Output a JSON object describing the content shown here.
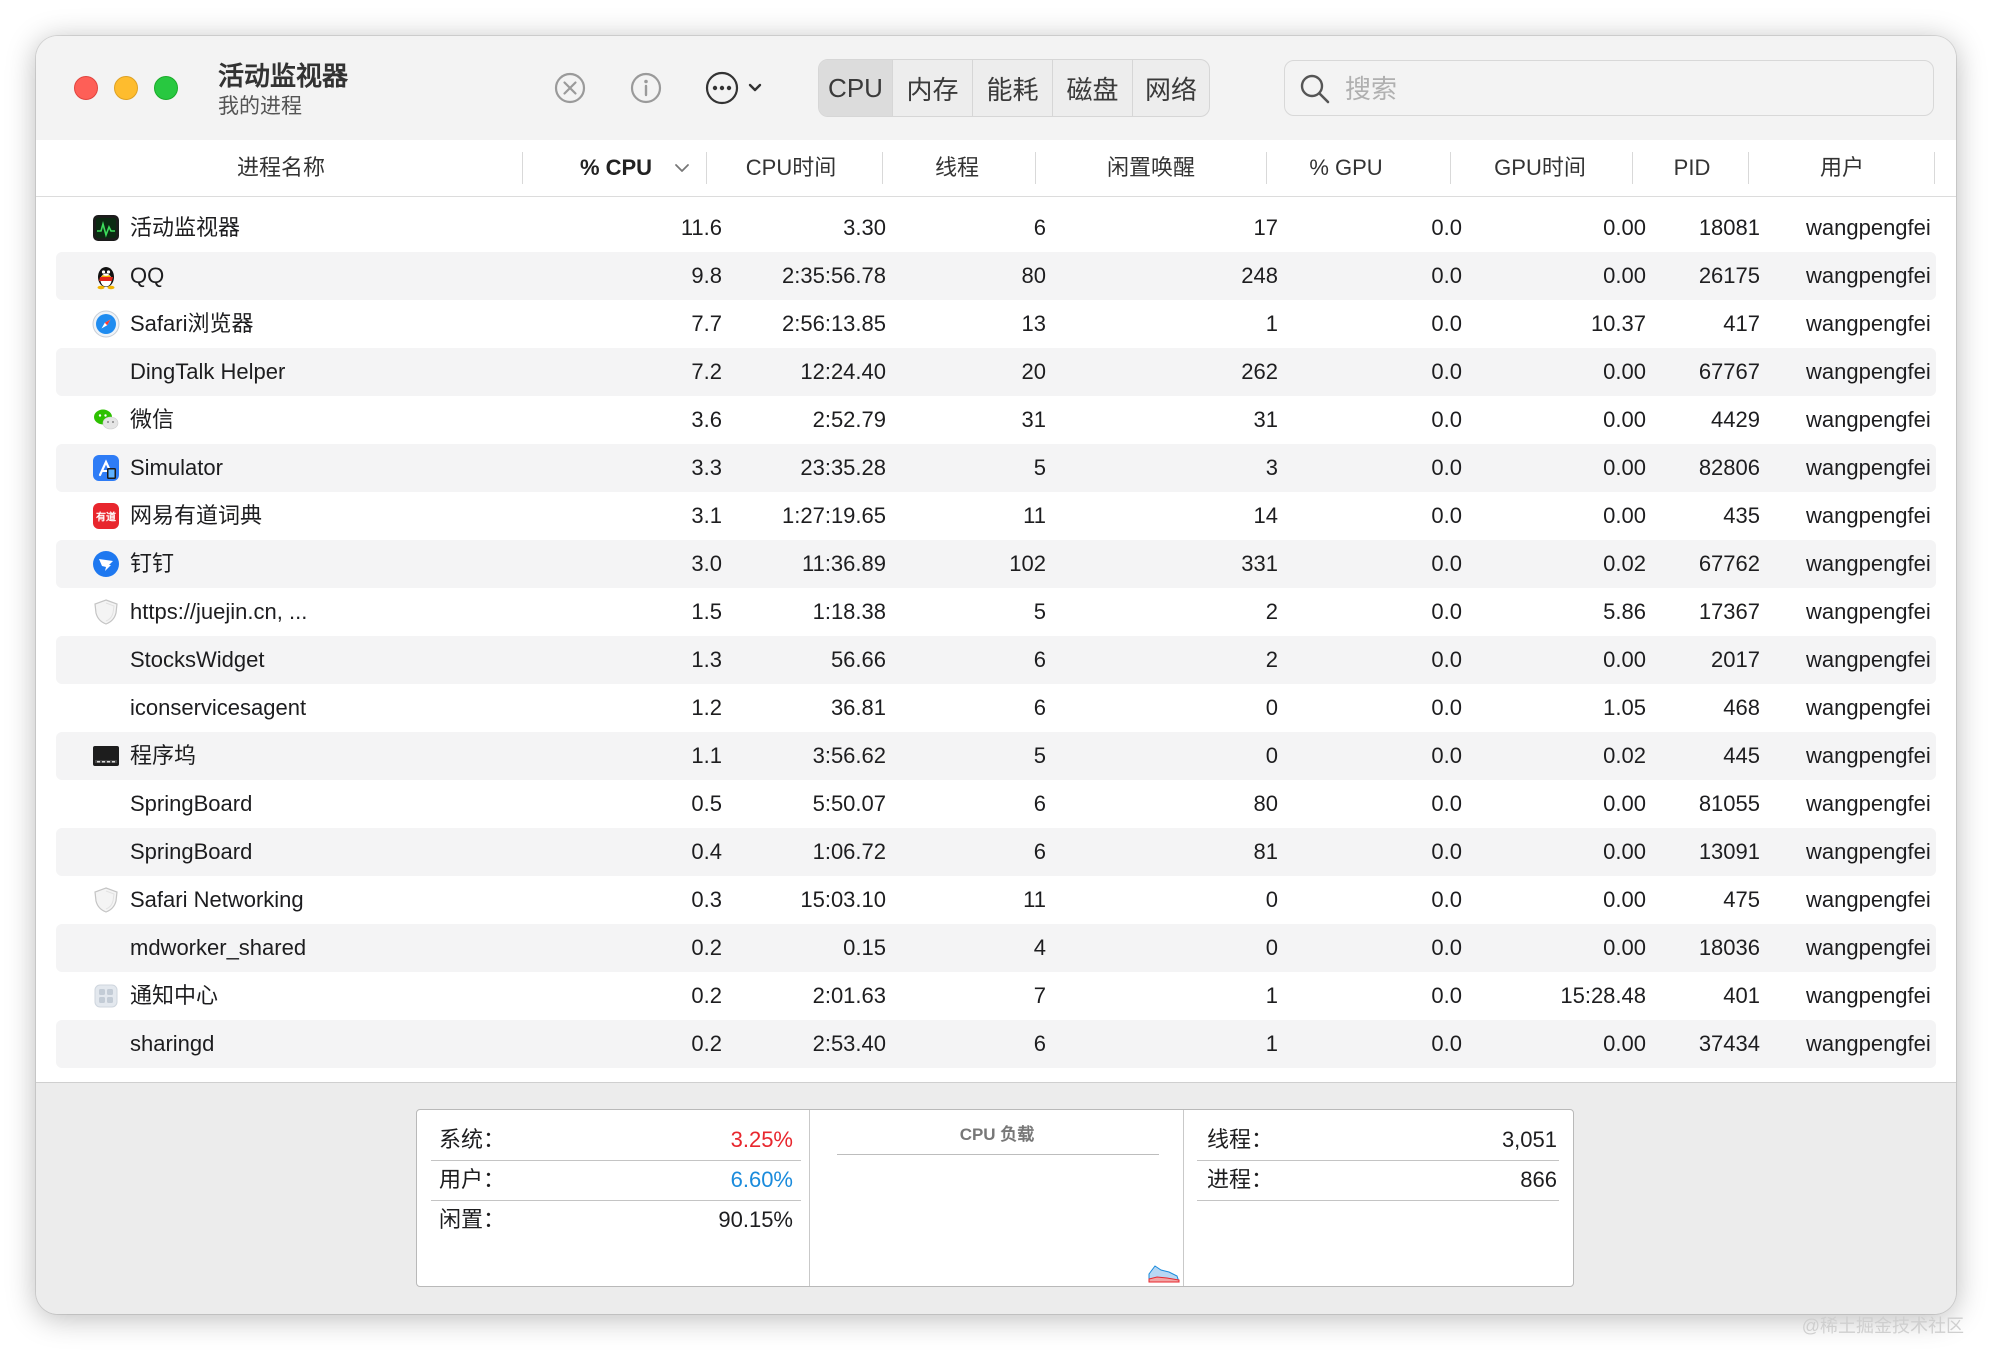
{
  "app": {
    "title": "活动监视器",
    "subtitle": "我的进程"
  },
  "toolbar": {
    "icons": [
      "stop-process-icon",
      "info-icon",
      "more-actions-icon"
    ],
    "tabs": [
      "CPU",
      "内存",
      "能耗",
      "磁盘",
      "网络"
    ],
    "active_tab": "CPU",
    "search": {
      "placeholder": "搜索",
      "value": ""
    }
  },
  "table": {
    "columns": [
      "进程名称",
      "% CPU",
      "CPU时间",
      "线程",
      "闲置唤醒",
      "% GPU",
      "GPU时间",
      "PID",
      "用户"
    ],
    "sort_column": "% CPU",
    "sort_direction": "descending",
    "rows": [
      {
        "icon": "activity-monitor-icon",
        "name": "活动监视器",
        "cpu": "11.6",
        "cpu_time": "3.30",
        "threads": "6",
        "idle_wakeups": "17",
        "gpu": "0.0",
        "gpu_time": "0.00",
        "pid": "18081",
        "user": "wangpengfei"
      },
      {
        "icon": "qq-penguin-icon",
        "name": "QQ",
        "cpu": "9.8",
        "cpu_time": "2:35:56.78",
        "threads": "80",
        "idle_wakeups": "248",
        "gpu": "0.0",
        "gpu_time": "0.00",
        "pid": "26175",
        "user": "wangpengfei"
      },
      {
        "icon": "safari-compass-icon",
        "name": "Safari浏览器",
        "cpu": "7.7",
        "cpu_time": "2:56:13.85",
        "threads": "13",
        "idle_wakeups": "1",
        "gpu": "0.0",
        "gpu_time": "10.37",
        "pid": "417",
        "user": "wangpengfei"
      },
      {
        "icon": "",
        "name": "DingTalk Helper",
        "cpu": "7.2",
        "cpu_time": "12:24.40",
        "threads": "20",
        "idle_wakeups": "262",
        "gpu": "0.0",
        "gpu_time": "0.00",
        "pid": "67767",
        "user": "wangpengfei"
      },
      {
        "icon": "wechat-icon",
        "name": "微信",
        "cpu": "3.6",
        "cpu_time": "2:52.79",
        "threads": "31",
        "idle_wakeups": "31",
        "gpu": "0.0",
        "gpu_time": "0.00",
        "pid": "4429",
        "user": "wangpengfei"
      },
      {
        "icon": "simulator-icon",
        "name": "Simulator",
        "cpu": "3.3",
        "cpu_time": "23:35.28",
        "threads": "5",
        "idle_wakeups": "3",
        "gpu": "0.0",
        "gpu_time": "0.00",
        "pid": "82806",
        "user": "wangpengfei"
      },
      {
        "icon": "youdao-dict-icon",
        "name": "网易有道词典",
        "cpu": "3.1",
        "cpu_time": "1:27:19.65",
        "threads": "11",
        "idle_wakeups": "14",
        "gpu": "0.0",
        "gpu_time": "0.00",
        "pid": "435",
        "user": "wangpengfei"
      },
      {
        "icon": "dingtalk-icon",
        "name": "钉钉",
        "cpu": "3.0",
        "cpu_time": "11:36.89",
        "threads": "102",
        "idle_wakeups": "331",
        "gpu": "0.0",
        "gpu_time": "0.02",
        "pid": "67762",
        "user": "wangpengfei"
      },
      {
        "icon": "shield-icon",
        "name": "https://juejin.cn, ...",
        "cpu": "1.5",
        "cpu_time": "1:18.38",
        "threads": "5",
        "idle_wakeups": "2",
        "gpu": "0.0",
        "gpu_time": "5.86",
        "pid": "17367",
        "user": "wangpengfei"
      },
      {
        "icon": "",
        "name": "StocksWidget",
        "cpu": "1.3",
        "cpu_time": "56.66",
        "threads": "6",
        "idle_wakeups": "2",
        "gpu": "0.0",
        "gpu_time": "0.00",
        "pid": "2017",
        "user": "wangpengfei"
      },
      {
        "icon": "",
        "name": "iconservicesagent",
        "cpu": "1.2",
        "cpu_time": "36.81",
        "threads": "6",
        "idle_wakeups": "0",
        "gpu": "0.0",
        "gpu_time": "1.05",
        "pid": "468",
        "user": "wangpengfei"
      },
      {
        "icon": "terminal-icon",
        "name": "程序坞",
        "cpu": "1.1",
        "cpu_time": "3:56.62",
        "threads": "5",
        "idle_wakeups": "0",
        "gpu": "0.0",
        "gpu_time": "0.02",
        "pid": "445",
        "user": "wangpengfei"
      },
      {
        "icon": "",
        "name": "SpringBoard",
        "cpu": "0.5",
        "cpu_time": "5:50.07",
        "threads": "6",
        "idle_wakeups": "80",
        "gpu": "0.0",
        "gpu_time": "0.00",
        "pid": "81055",
        "user": "wangpengfei"
      },
      {
        "icon": "",
        "name": "SpringBoard",
        "cpu": "0.4",
        "cpu_time": "1:06.72",
        "threads": "6",
        "idle_wakeups": "81",
        "gpu": "0.0",
        "gpu_time": "0.00",
        "pid": "13091",
        "user": "wangpengfei"
      },
      {
        "icon": "shield-icon",
        "name": "Safari Networking",
        "cpu": "0.3",
        "cpu_time": "15:03.10",
        "threads": "11",
        "idle_wakeups": "0",
        "gpu": "0.0",
        "gpu_time": "0.00",
        "pid": "475",
        "user": "wangpengfei"
      },
      {
        "icon": "",
        "name": "mdworker_shared",
        "cpu": "0.2",
        "cpu_time": "0.15",
        "threads": "4",
        "idle_wakeups": "0",
        "gpu": "0.0",
        "gpu_time": "0.00",
        "pid": "18036",
        "user": "wangpengfei"
      },
      {
        "icon": "notification-center-icon",
        "name": "通知中心",
        "cpu": "0.2",
        "cpu_time": "2:01.63",
        "threads": "7",
        "idle_wakeups": "1",
        "gpu": "0.0",
        "gpu_time": "15:28.48",
        "pid": "401",
        "user": "wangpengfei"
      },
      {
        "icon": "",
        "name": "sharingd",
        "cpu": "0.2",
        "cpu_time": "2:53.40",
        "threads": "6",
        "idle_wakeups": "1",
        "gpu": "0.0",
        "gpu_time": "0.00",
        "pid": "37434",
        "user": "wangpengfei"
      }
    ]
  },
  "summary": {
    "system_label": "系统：",
    "system_value": "3.25%",
    "user_label": "用户：",
    "user_value": "6.60%",
    "idle_label": "闲置：",
    "idle_value": "90.15%",
    "chart_title": "CPU 负载",
    "threads_label": "线程：",
    "threads_value": "3,051",
    "processes_label": "进程：",
    "processes_value": "866"
  },
  "colors": {
    "system": "#e8262d",
    "user": "#1a8bdc",
    "alt_row": "#f4f4f5"
  },
  "watermark": "@稀土掘金技术社区"
}
